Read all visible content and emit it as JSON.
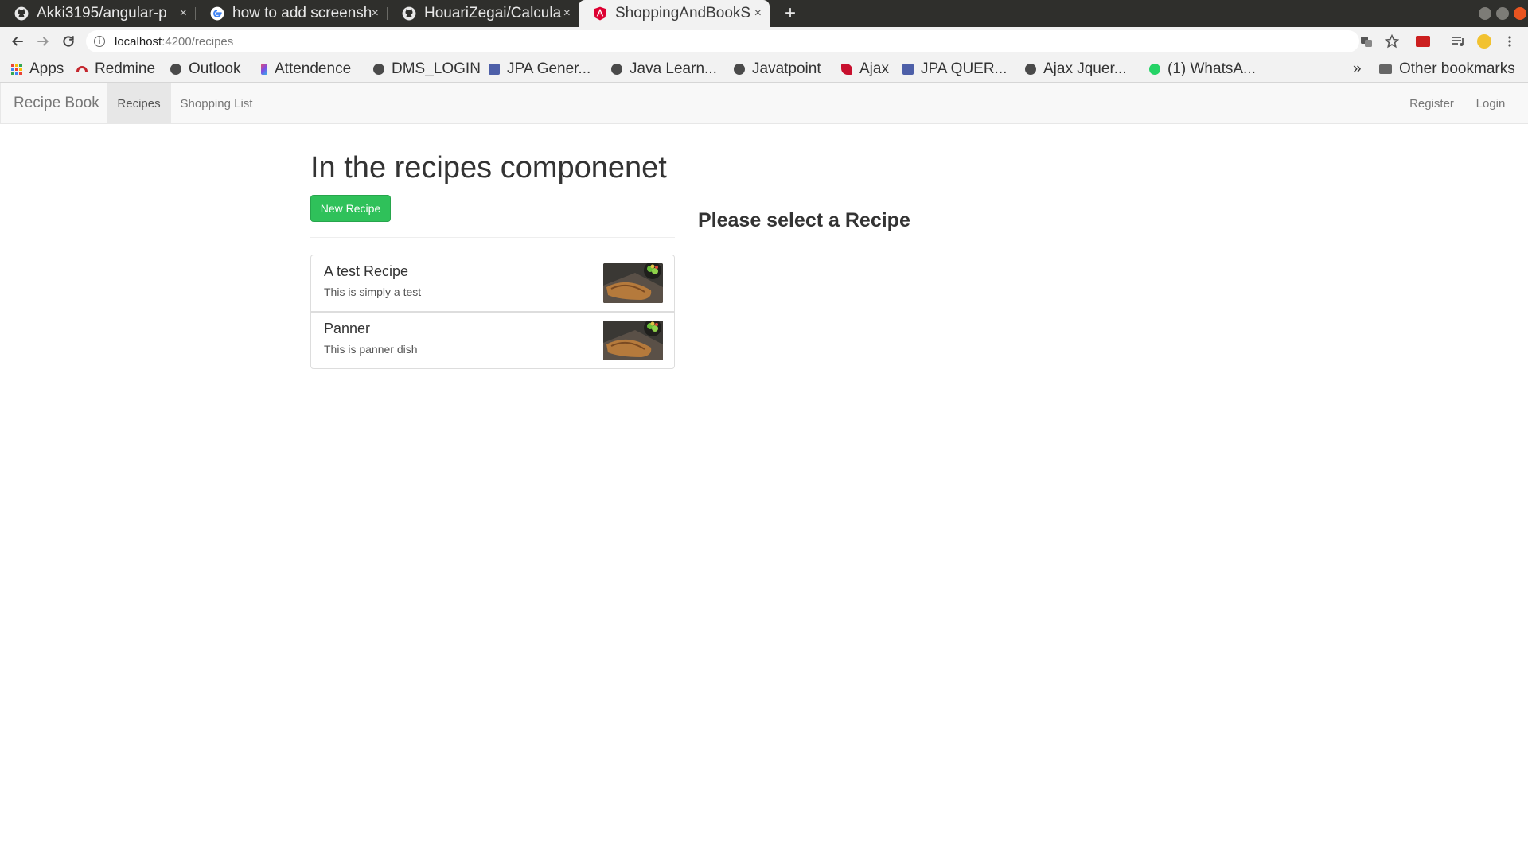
{
  "browser": {
    "tabs": [
      {
        "title": "Akki3195/angular-p",
        "icon": "github-icon",
        "active": false
      },
      {
        "title": "how to add screensh",
        "icon": "google-icon",
        "active": false
      },
      {
        "title": "HouariZegai/Calcula",
        "icon": "github-icon",
        "active": false
      },
      {
        "title": "ShoppingAndBookS",
        "icon": "angular-icon",
        "active": true
      }
    ],
    "new_tab_label": "+",
    "close_glyph": "×",
    "url_host": "localhost",
    "url_path": ":4200/recipes",
    "bookmarks": [
      {
        "label": "Apps",
        "icon": "apps-grid-icon"
      },
      {
        "label": "Redmine",
        "icon": "redmine-icon"
      },
      {
        "label": "Outlook",
        "icon": "globe-icon"
      },
      {
        "label": "Attendence",
        "icon": "attendence-icon"
      },
      {
        "label": "DMS_LOGIN",
        "icon": "globe-icon"
      },
      {
        "label": "JPA Gener...",
        "icon": "doc-icon"
      },
      {
        "label": "Java Learn...",
        "icon": "globe-icon"
      },
      {
        "label": "Javatpoint",
        "icon": "globe-icon"
      },
      {
        "label": "Ajax",
        "icon": "ajax-icon"
      },
      {
        "label": "JPA QUER...",
        "icon": "doc-icon"
      },
      {
        "label": "Ajax Jquer...",
        "icon": "globe-icon"
      },
      {
        "label": "(1) WhatsA...",
        "icon": "whatsapp-icon"
      }
    ],
    "bookmarks_overflow": "»",
    "other_bookmarks": "Other bookmarks"
  },
  "navbar": {
    "brand": "Recipe Book",
    "links": [
      {
        "label": "Recipes",
        "active": true
      },
      {
        "label": "Shopping List",
        "active": false
      }
    ],
    "register": "Register",
    "login": "Login"
  },
  "main": {
    "title": "In the recipes componenet",
    "new_recipe_button": "New Recipe",
    "recipes": [
      {
        "name": "A test Recipe",
        "description": "This is simply a test"
      },
      {
        "name": "Panner",
        "description": "This is panner dish"
      }
    ],
    "detail_placeholder": "Please select a Recipe"
  },
  "colors": {
    "accent_green": "#2fc15a",
    "navbar_bg": "#f8f8f8",
    "tabstrip_bg": "#2f2f2c"
  }
}
